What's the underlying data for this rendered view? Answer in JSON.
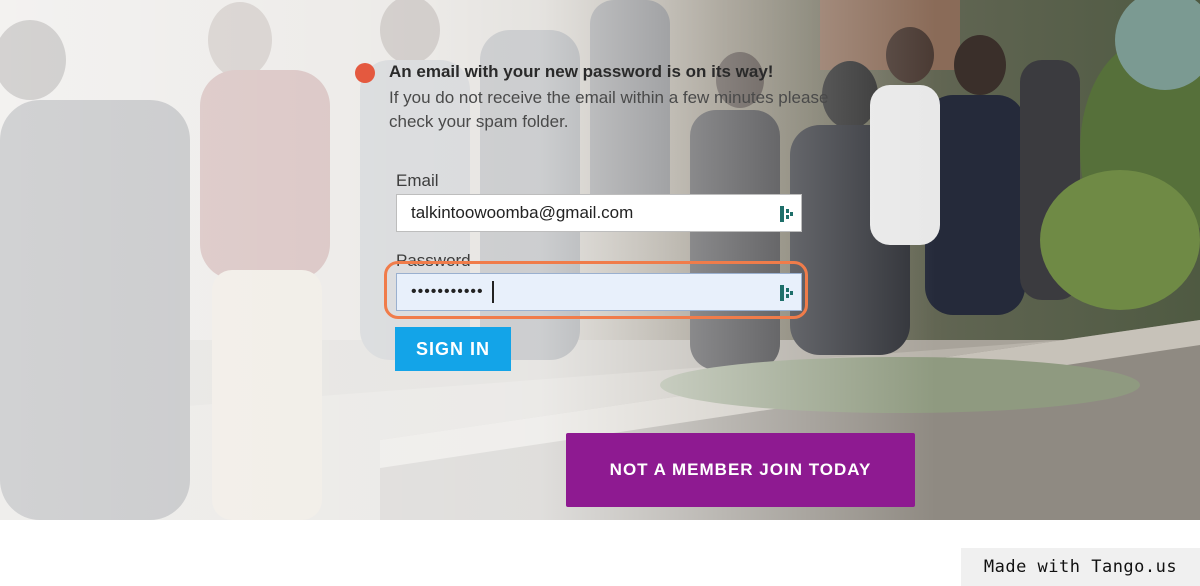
{
  "notice": {
    "title": "An email with your new password is on its way!",
    "body": "If you do not receive the email within a few minutes please check your spam folder.",
    "icon": "status-dot-icon",
    "color": "#e4593f"
  },
  "form": {
    "email_label": "Email",
    "email_value": "talkintoowoomba@gmail.com",
    "password_label": "Password",
    "password_value": "•••••••••••",
    "password_manager_icon": "password-manager-icon",
    "signin_label": "SIGN IN"
  },
  "join": {
    "label": "NOT A MEMBER JOIN TODAY"
  },
  "watermark": {
    "text": "Made with Tango.us"
  },
  "colors": {
    "signin_bg": "#13a4e8",
    "join_bg": "#8e1a91",
    "focus_ring": "#f07c4a"
  }
}
